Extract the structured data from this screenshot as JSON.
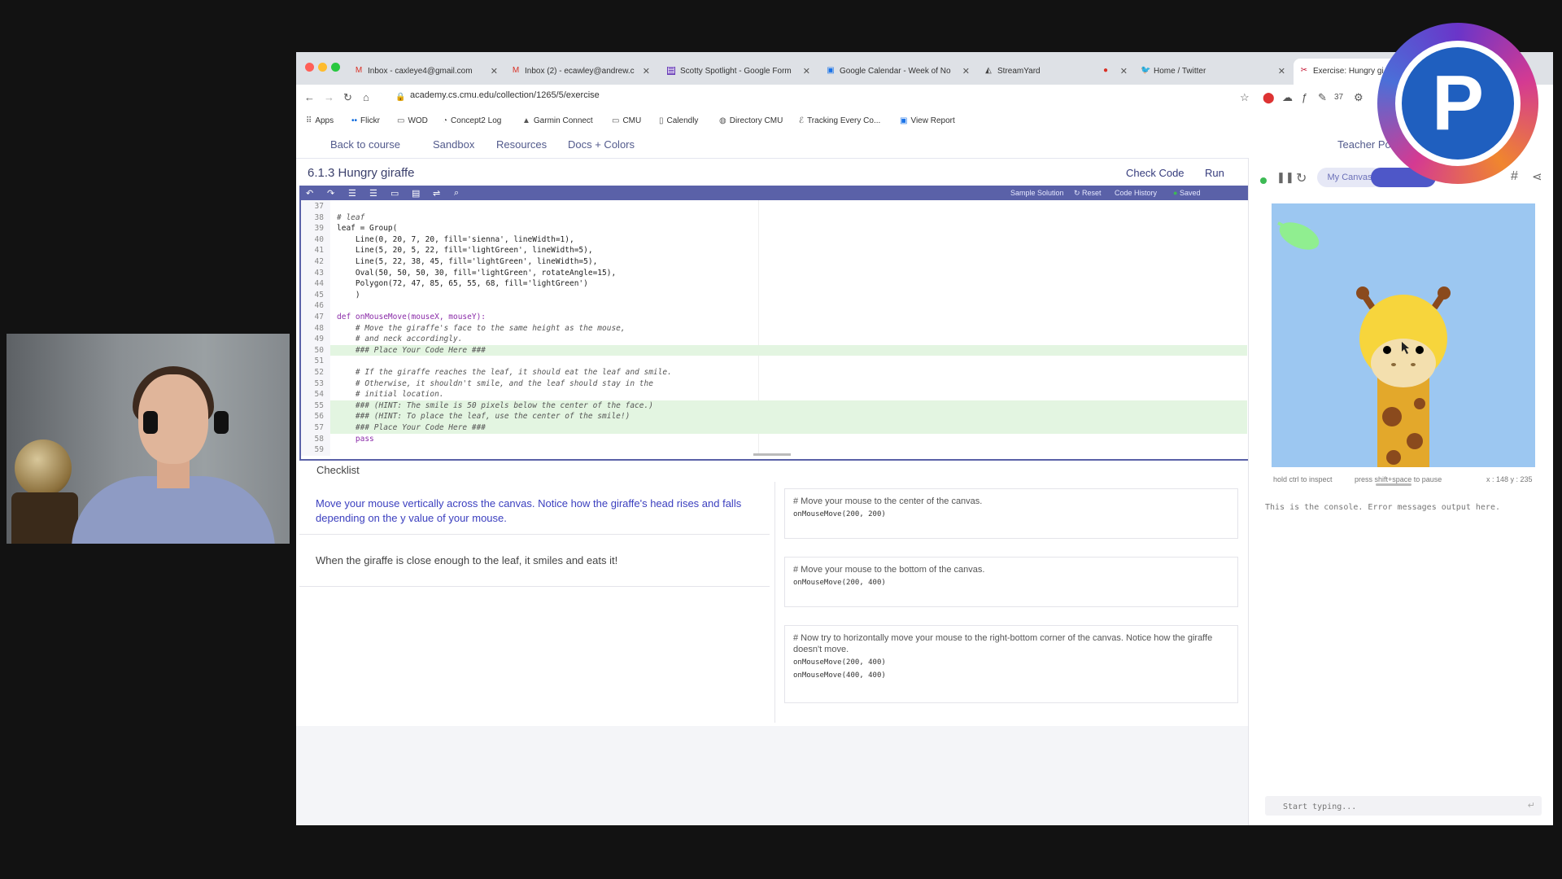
{
  "browser": {
    "tabs": [
      {
        "label": "Inbox - caxleye4@gmail.com",
        "icon": "gmail-icon"
      },
      {
        "label": "Inbox (2) - ecawley@andrew.c",
        "icon": "gmail-icon"
      },
      {
        "label": "Scotty Spotlight - Google Form",
        "icon": "forms-icon"
      },
      {
        "label": "Google Calendar - Week of No",
        "icon": "calendar-icon"
      },
      {
        "label": "StreamYard",
        "icon": "streamyard-icon"
      },
      {
        "label": "",
        "icon": "extension-icon"
      },
      {
        "label": "Home / Twitter",
        "icon": "twitter-icon"
      },
      {
        "label": "Exercise: Hungry gi",
        "icon": "cmu-icon"
      }
    ],
    "url": "academy.cs.cmu.edu/collection/1265/5/exercise",
    "bookmarks": [
      "Apps",
      "Flickr",
      "WOD",
      "Concept2 Log",
      "Garmin Connect",
      "CMU",
      "Calendly",
      "Directory CMU",
      "Tracking Every Co...",
      "View Report"
    ],
    "ext_badge": "37"
  },
  "site_nav": {
    "back": "Back to course",
    "sandbox": "Sandbox",
    "resources": "Resources",
    "docs": "Docs + Colors",
    "teacher": "Teacher Portal"
  },
  "exercise": {
    "title": "6.1.3 Hungry giraffe",
    "check_code": "Check Code",
    "run": "Run"
  },
  "toolbar": {
    "sample_solution": "Sample Solution",
    "reset": "Reset",
    "code_history": "Code History",
    "saved": "Saved"
  },
  "code": {
    "line_numbers": [
      "37",
      "38",
      "39",
      "40",
      "41",
      "42",
      "43",
      "44",
      "45",
      "46",
      "47",
      "48",
      "49",
      "50",
      "51",
      "52",
      "53",
      "54",
      "55",
      "56",
      "57",
      "58",
      "59"
    ],
    "lines": [
      "",
      "# leaf",
      "leaf = Group(",
      "    Line(0, 20, 7, 20, fill='sienna', lineWidth=1),",
      "    Line(5, 20, 5, 22, fill='lightGreen', lineWidth=5),",
      "    Line(5, 22, 38, 45, fill='lightGreen', lineWidth=5),",
      "    Oval(50, 50, 50, 30, fill='lightGreen', rotateAngle=15),",
      "    Polygon(72, 47, 85, 65, 55, 68, fill='lightGreen')",
      "    )",
      "",
      "def onMouseMove(mouseX, mouseY):",
      "    # Move the giraffe's face to the same height as the mouse,",
      "    # and neck accordingly.",
      "    ### Place Your Code Here ###",
      "",
      "    # If the giraffe reaches the leaf, it should eat the leaf and smile.",
      "    # Otherwise, it shouldn't smile, and the leaf should stay in the",
      "    # initial location.",
      "    ### (HINT: The smile is 50 pixels below the center of the face.)",
      "    ### (HINT: To place the leaf, use the center of the smile!)",
      "    ### Place Your Code Here ###",
      "    pass",
      ""
    ]
  },
  "checklist": {
    "label": "Checklist",
    "items": [
      {
        "description": "Move your mouse vertically across the canvas. Notice how the giraffe's head rises and falls depending on the y value of your mouse.",
        "comment": "# Move your mouse to the center of the canvas.",
        "calls": [
          "onMouseMove(200, 200)"
        ]
      },
      {
        "description": "When the giraffe is close enough to the leaf, it smiles and eats it!",
        "comment": "# Move your mouse to the bottom of the canvas.",
        "calls": [
          "onMouseMove(200, 400)"
        ]
      },
      {
        "description": "",
        "comment": "# Now try to horizontally move your mouse to the right-bottom corner of the canvas. Notice how the giraffe doesn't move.",
        "calls": [
          "onMouseMove(200, 400)",
          "onMouseMove(400, 400)"
        ]
      }
    ]
  },
  "canvas_panel": {
    "my_canvas": "My Canvas",
    "other_canvas": "",
    "hint_inspect": "hold ctrl to inspect",
    "hint_pause": "press shift+space to pause",
    "coords": "x : 148 y : 235",
    "console_message": "This is the console. Error messages output here.",
    "console_placeholder": "Start typing..."
  },
  "colors": {
    "accent": "#5a61a8",
    "canvas_bg": "#9cc7f1",
    "highlight": "#e3f5e1"
  }
}
